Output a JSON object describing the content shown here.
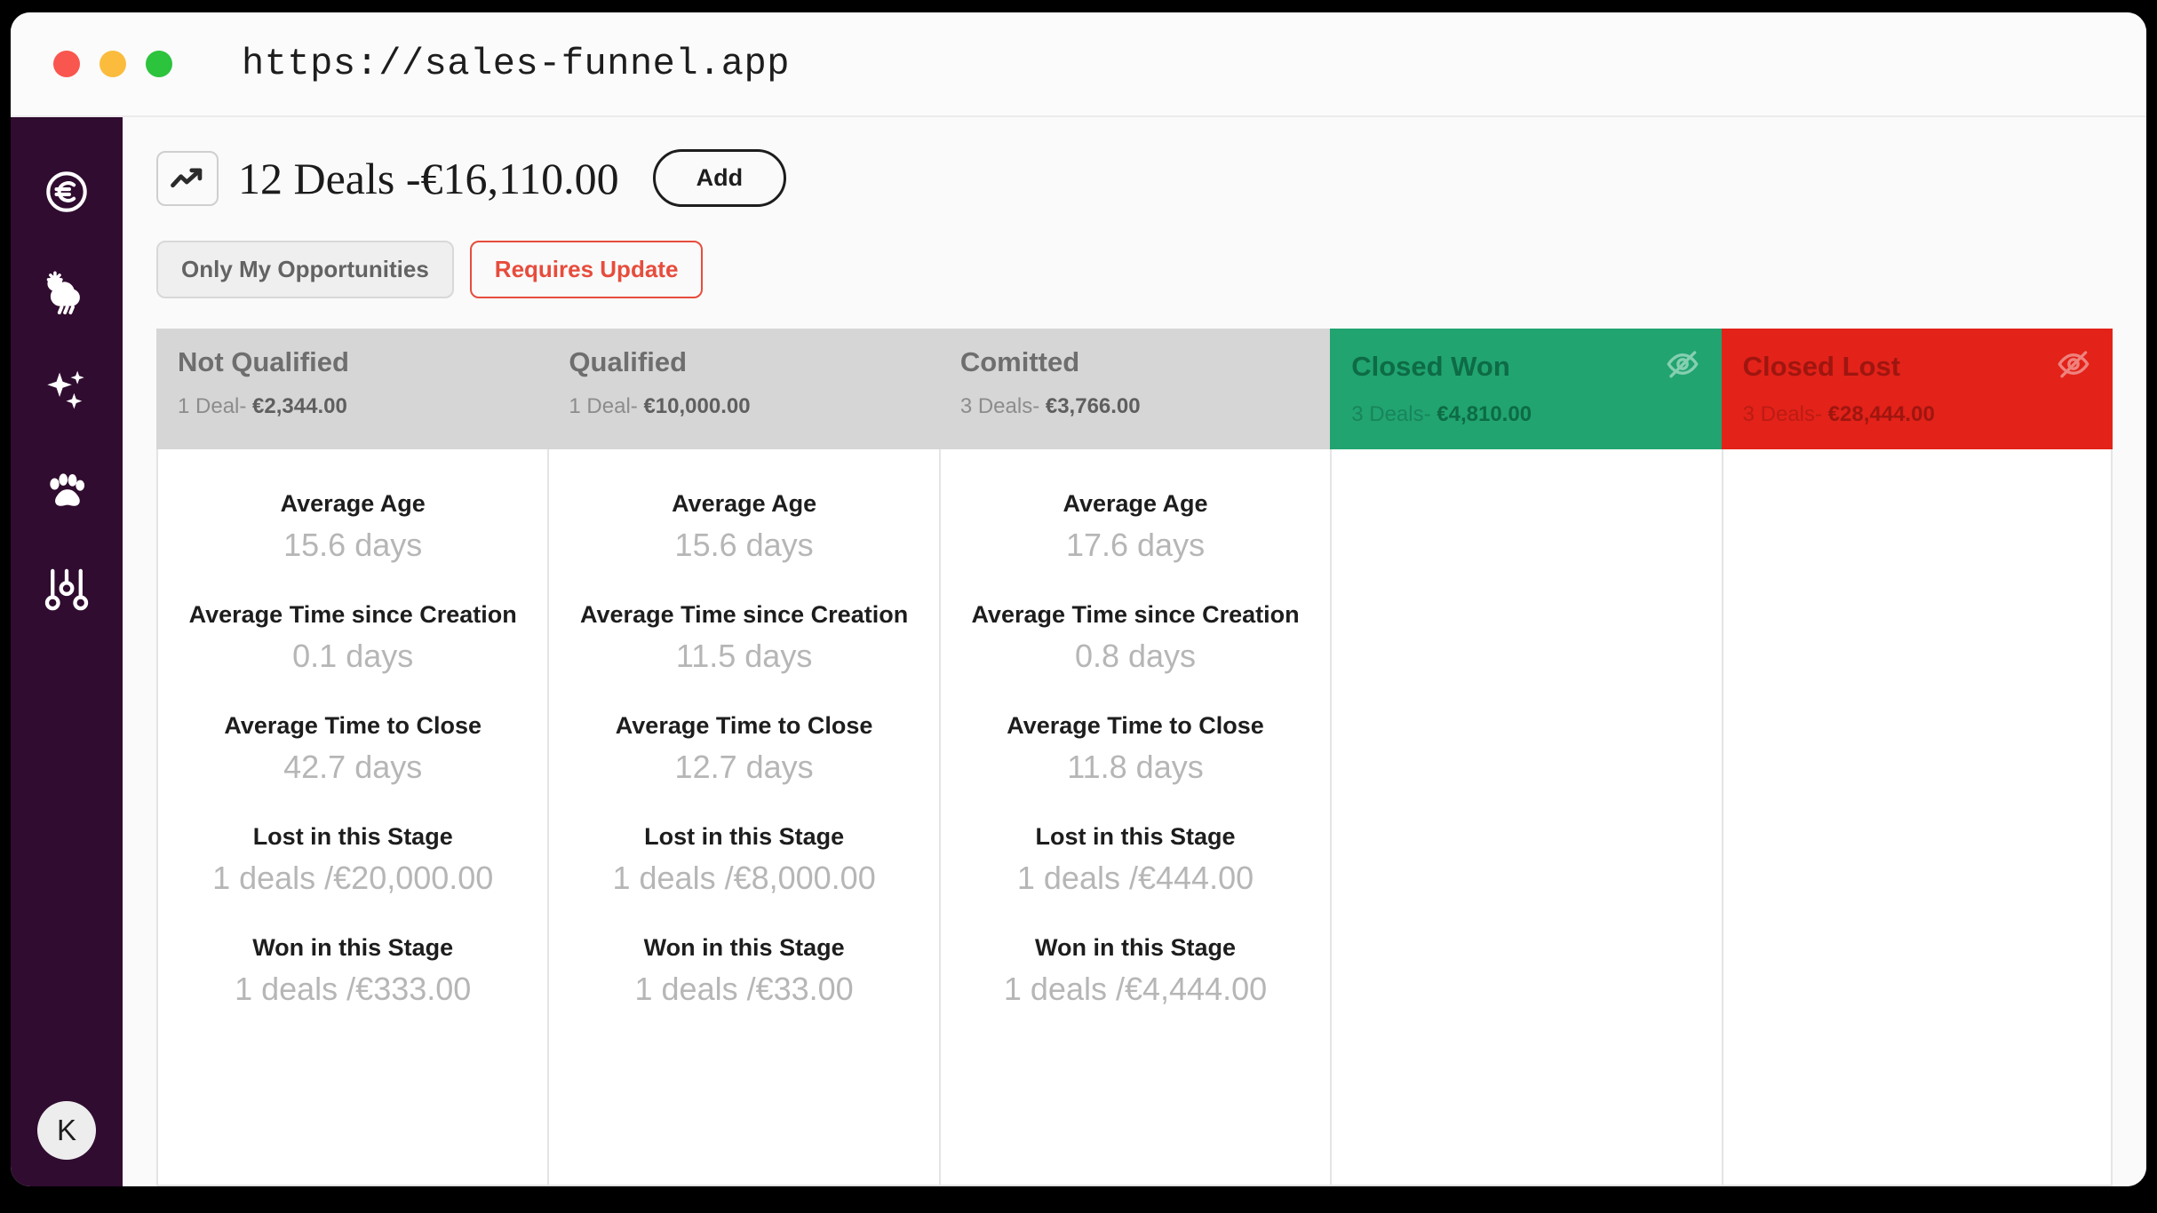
{
  "browser": {
    "url": "https://sales-funnel.app",
    "traffic_lights": [
      "close",
      "minimize",
      "maximize"
    ]
  },
  "sidebar": {
    "items": [
      {
        "icon": "euro-circle-icon",
        "name": "sidebar-item-currency"
      },
      {
        "icon": "sun-rain-icon",
        "name": "sidebar-item-weather"
      },
      {
        "icon": "sparkles-icon",
        "name": "sidebar-item-sparkles"
      },
      {
        "icon": "paw-print-icon",
        "name": "sidebar-item-pets"
      },
      {
        "icon": "sliders-icon",
        "name": "sidebar-item-settings"
      }
    ],
    "avatar_initial": "K"
  },
  "header": {
    "icon": "trending-up-icon",
    "title": "12 Deals -€16,110.00",
    "add_label": "Add"
  },
  "filters": [
    {
      "label": "Only My Opportunities",
      "style": "neutral",
      "name": "filter-only-my-opportunities"
    },
    {
      "label": "Requires Update",
      "style": "danger",
      "name": "filter-requires-update"
    }
  ],
  "colors": {
    "sidebar": "#300c30",
    "header_gray": "#d6d6d6",
    "won_green": "#21a470",
    "lost_red": "#e32219",
    "danger_text": "#e74c3c",
    "value_gray": "#b6b6b6"
  },
  "board": {
    "metric_labels": {
      "average_age": "Average Age",
      "time_since_creation": "Average Time since Creation",
      "time_to_close": "Average Time to Close",
      "lost_in_stage": "Lost in this Stage",
      "won_in_stage": "Won in this Stage"
    },
    "columns": [
      {
        "title": "Not Qualified",
        "deals_count": "1 Deal- ",
        "deals_amount": "€2,344.00",
        "style": "gray",
        "hide_icon": false,
        "metrics": {
          "average_age": "15.6 days",
          "time_since_creation": "0.1 days",
          "time_to_close": "42.7 days",
          "lost_in_stage": "1 deals /€20,000.00",
          "won_in_stage": "1 deals /€333.00"
        }
      },
      {
        "title": "Qualified",
        "deals_count": "1 Deal- ",
        "deals_amount": "€10,000.00",
        "style": "gray",
        "hide_icon": false,
        "metrics": {
          "average_age": "15.6 days",
          "time_since_creation": "11.5 days",
          "time_to_close": "12.7 days",
          "lost_in_stage": "1 deals /€8,000.00",
          "won_in_stage": "1 deals /€33.00"
        }
      },
      {
        "title": "Comitted",
        "deals_count": "3 Deals- ",
        "deals_amount": "€3,766.00",
        "style": "gray",
        "hide_icon": false,
        "metrics": {
          "average_age": "17.6 days",
          "time_since_creation": "0.8 days",
          "time_to_close": "11.8 days",
          "lost_in_stage": "1 deals /€444.00",
          "won_in_stage": "1 deals /€4,444.00"
        }
      },
      {
        "title": "Closed Won",
        "deals_count": "3 Deals- ",
        "deals_amount": "€4,810.00",
        "style": "won",
        "hide_icon": true,
        "metrics": {}
      },
      {
        "title": "Closed Lost",
        "deals_count": "3 Deals- ",
        "deals_amount": "€28,444.00",
        "style": "lost",
        "hide_icon": true,
        "metrics": {}
      }
    ]
  }
}
